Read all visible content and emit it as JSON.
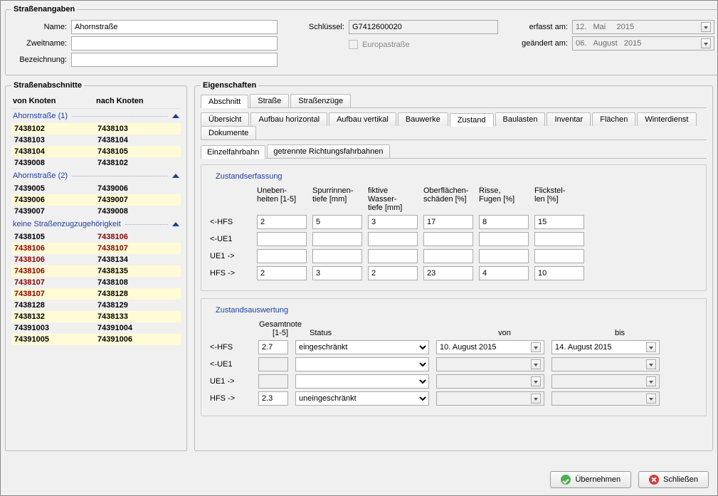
{
  "header": {
    "title": "Straßenangaben",
    "labels": {
      "name": "Name:",
      "zweitname": "Zweitname:",
      "bezeichnung": "Bezeichnung:",
      "schluessel": "Schlüssel:",
      "europastrasse": "Europastraße",
      "erfasst": "erfasst am:",
      "geaendert": "geändert am:"
    },
    "values": {
      "name": "Ahornstraße",
      "zweitname": "",
      "bezeichnung": "",
      "schluessel": "G7412600020",
      "erfasst_d": "12.",
      "erfasst_m": "Mai",
      "erfasst_y": "2015",
      "geaendert_d": "06.",
      "geaendert_m": "August",
      "geaendert_y": "2015"
    }
  },
  "abschnitte": {
    "title": "Straßenabschnitte",
    "col1": "von Knoten",
    "col2": "nach Knoten",
    "groups": [
      {
        "label": "Ahornstraße (1)",
        "rows": [
          {
            "a": "7438102",
            "b": "7438103",
            "hl": true
          },
          {
            "a": "7438103",
            "b": "7438104",
            "hl": false
          },
          {
            "a": "7438104",
            "b": "7438105",
            "hl": true
          },
          {
            "a": "7439008",
            "b": "7438102",
            "hl": false
          }
        ]
      },
      {
        "label": "Ahornstraße (2)",
        "rows": [
          {
            "a": "7439005",
            "b": "7439006",
            "hl": false
          },
          {
            "a": "7439006",
            "b": "7439007",
            "hl": true
          },
          {
            "a": "7439007",
            "b": "7439008",
            "hl": false
          }
        ]
      },
      {
        "label": "keine Straßenzugzugehörigkeit",
        "rows": [
          {
            "a": "7438105",
            "b": "7438106",
            "hl": false,
            "bRed": true
          },
          {
            "a": "7438106",
            "b": "7438107",
            "hl": true,
            "aRed": true,
            "bRed": true
          },
          {
            "a": "7438106",
            "b": "7438134",
            "hl": false,
            "aRed": true
          },
          {
            "a": "7438106",
            "b": "7438135",
            "hl": true,
            "aRed": true
          },
          {
            "a": "7438107",
            "b": "7438108",
            "hl": false,
            "aRed": true
          },
          {
            "a": "7438107",
            "b": "7438128",
            "hl": true,
            "aRed": true
          },
          {
            "a": "7438128",
            "b": "7438129",
            "hl": false
          },
          {
            "a": "7438132",
            "b": "7438133",
            "hl": true
          },
          {
            "a": "74391003",
            "b": "74391004",
            "hl": false
          },
          {
            "a": "74391005",
            "b": "74391006",
            "hl": true
          }
        ]
      }
    ]
  },
  "eigenschaften": {
    "title": "Eigenschaften",
    "tabs_main": [
      "Abschnitt",
      "Straße",
      "Straßenzüge"
    ],
    "tabs_sub": [
      "Übersicht",
      "Aufbau horizontal",
      "Aufbau vertikal",
      "Bauwerke",
      "Zustand",
      "Baulasten",
      "Inventar",
      "Flächen",
      "Winterdienst",
      "Dokumente"
    ],
    "tabs_lane": [
      "Einzelfahrbahn",
      "getrennte Richtungsfahrbahnen"
    ],
    "main_active": 0,
    "sub_active": 4,
    "lane_active": 0,
    "zerfassung": {
      "title": "Zustandserfassung",
      "cols": [
        "Uneben-\nheiten [1-5]",
        "Spurrinnen-\ntiefe [mm]",
        "fiktive Wasser-\ntiefe [mm]",
        "Oberflächen-\nschäden [%]",
        "Risse,\nFugen [%]",
        "Flickstel-\nlen [%]"
      ],
      "rows": [
        {
          "label": "<-HFS",
          "vals": [
            "2",
            "5",
            "3",
            "17",
            "8",
            "15"
          ]
        },
        {
          "label": "<-UE1",
          "vals": [
            "",
            "",
            "",
            "",
            "",
            ""
          ]
        },
        {
          "label": "UE1 ->",
          "vals": [
            "",
            "",
            "",
            "",
            "",
            ""
          ]
        },
        {
          "label": "HFS ->",
          "vals": [
            "2",
            "3",
            "2",
            "23",
            "4",
            "10"
          ]
        }
      ]
    },
    "zauswertung": {
      "title": "Zustandsauswertung",
      "head_note": "Gesamtnote\n[1-5]",
      "head_status": "Status",
      "head_von": "von",
      "head_bis": "bis",
      "rows": [
        {
          "label": "<-HFS",
          "note": "2.7",
          "status": "eingeschränkt",
          "von": "10.  August   2015",
          "bis": "14.  August   2015",
          "active": true
        },
        {
          "label": "<-UE1",
          "note": "",
          "status": "",
          "von": "",
          "bis": "",
          "active": false
        },
        {
          "label": "UE1 ->",
          "note": "",
          "status": "",
          "von": "",
          "bis": "",
          "active": false
        },
        {
          "label": "HFS ->",
          "note": "2.3",
          "status": "uneingeschränkt",
          "von": "",
          "bis": "",
          "active": false
        }
      ]
    }
  },
  "footer": {
    "ok": "Übernehmen",
    "close": "Schließen"
  }
}
